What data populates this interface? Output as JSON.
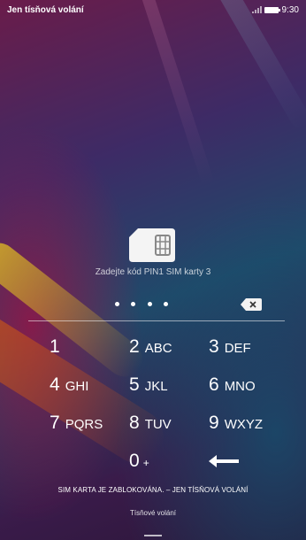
{
  "status_bar": {
    "carrier_text": "Jen tísňová volání",
    "time": "9:30"
  },
  "sim_prompt": "Zadejte kód PIN1 SIM karty 3",
  "pin": {
    "entered_digits": 4
  },
  "keypad": {
    "rows": [
      [
        {
          "num": "1",
          "letters": ""
        },
        {
          "num": "2",
          "letters": "ABC"
        },
        {
          "num": "3",
          "letters": "DEF"
        }
      ],
      [
        {
          "num": "4",
          "letters": "GHI"
        },
        {
          "num": "5",
          "letters": "JKL"
        },
        {
          "num": "6",
          "letters": "MNO"
        }
      ],
      [
        {
          "num": "7",
          "letters": "PQRS"
        },
        {
          "num": "8",
          "letters": "TUV"
        },
        {
          "num": "9",
          "letters": "WXYZ"
        }
      ]
    ],
    "zero": {
      "num": "0",
      "letters": "+"
    }
  },
  "sim_locked_text": "SIM KARTA JE ZABLOKOVÁNA. – JEN TÍSŇOVÁ VOLÁNÍ",
  "emergency_call_label": "Tísňové volání",
  "icons": {
    "sim": "sim-card-icon",
    "delete": "delete-icon",
    "backspace": "backspace-arrow-icon",
    "battery": "battery-icon",
    "signal": "signal-icon"
  }
}
